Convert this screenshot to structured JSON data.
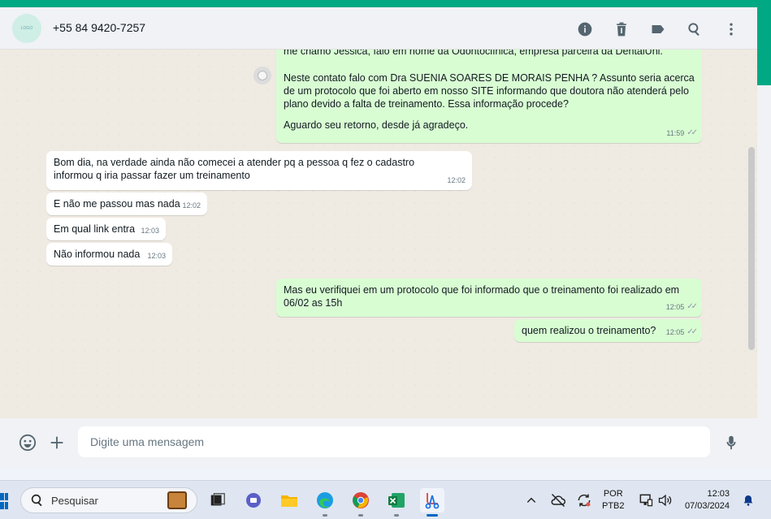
{
  "header": {
    "avatar_text": "LOGO",
    "contact": "+55 84 9420-7257",
    "icons": [
      "info-icon",
      "trash-icon",
      "label-icon",
      "search-icon",
      "more-vert-icon"
    ]
  },
  "messages": {
    "m0": {
      "partial_line": "me chamo Jessica, falo em nome da Odontoclínica, empresa parceira da DentalUni.",
      "p1": "Neste contato falo com Dra  SUENIA SOARES DE MORAIS PENHA ? Assunto seria acerca de um protocolo que foi aberto em nosso SITE informando que doutora não atenderá pelo plano devido a falta de treinamento. Essa informação procede?",
      "p2": "Aguardo seu retorno, desde já agradeço.",
      "time": "11:59"
    },
    "m1": {
      "text": "Bom dia, na verdade ainda não comecei a atender pq a pessoa q fez o cadastro informou q iria passar fazer um treinamento",
      "time": "12:02"
    },
    "m2": {
      "text": "E não me passou mas nada",
      "time": "12:02"
    },
    "m3": {
      "text": "Em qual link entra",
      "time": "12:03"
    },
    "m4": {
      "text": "Não informou nada",
      "time": "12:03"
    },
    "m5": {
      "text": "Mas eu verifiquei em um protocolo que foi informado que o treinamento foi realizado em 06/02 as 15h",
      "time": "12:05"
    },
    "m6": {
      "text": "quem realizou o treinamento?",
      "time": "12:05"
    }
  },
  "compose": {
    "placeholder": "Digite uma mensagem"
  },
  "taskbar": {
    "search_label": "Pesquisar",
    "lang_line1": "POR",
    "lang_line2": "PTB2",
    "time": "12:03",
    "date": "07/03/2024"
  },
  "colors": {
    "accent": "#00a884",
    "outgoing_bubble": "#d9fdd3",
    "incoming_bubble": "#ffffff",
    "chat_bg": "#efeae2"
  }
}
